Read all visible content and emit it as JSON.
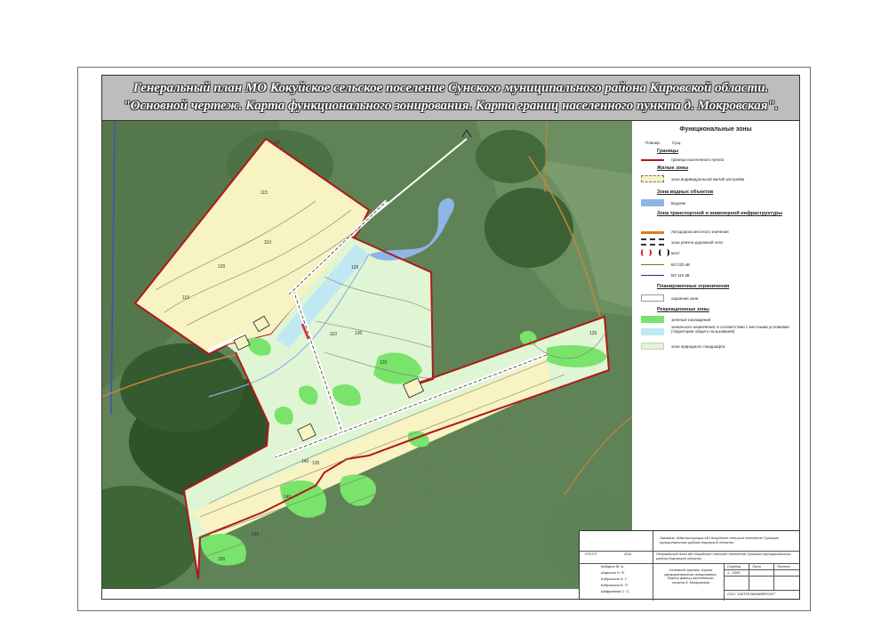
{
  "title": {
    "line1": "Генеральный план МО Кокуйское сельское поселение Сунского муниципального района Кировской области.",
    "line2": "\"Основной чертеж. Карта функционального зонирования. Карта границ населенного пункта д. Мокровская\"."
  },
  "map": {
    "contours": [
      "155",
      "140",
      "115",
      "110",
      "120",
      "115",
      "125",
      "130",
      "110",
      "125",
      "130",
      "135",
      "140",
      "145",
      "150"
    ]
  },
  "legend": {
    "title": "Функциональные зоны",
    "col_plan": "Планир.",
    "col_exist": "Сущ.",
    "sections": {
      "borders": "Границы",
      "living": "Жилые зоны",
      "water": "Зона водных объектов",
      "transport": "Зона транспортной и инженерной инфраструктуры",
      "restrictions": "Планировочные ограничения",
      "recreation": "Рекреационные зоны"
    },
    "items": {
      "border": "граница населенного пункта",
      "individual": "зона индивидуальной жилой застройки",
      "water": "Водоем",
      "road_local": "Автодорога местного значения",
      "street_net": "зона улично-дорожной сети",
      "bridge": "мост",
      "vl220": "ВЛ 220 кВ",
      "vl110": "ВЛ 110 кВ",
      "protect": "охранная зона",
      "green": "зеленые насаждения",
      "zonal": "зонального назначения, в соответствии с местными условиями (территории общего пользования)",
      "natural": "зона природного ландшафта"
    },
    "colors": {
      "border": "#b01818",
      "individual": "#f7f3c2",
      "water": "#8fb4e8",
      "road": "#e07b1e",
      "vl220": "#7a7a1e",
      "vl110": "#2a2a8a",
      "green": "#79e36b",
      "zonal": "#bfe8f2",
      "natural": "#dff5d3"
    }
  },
  "stamp": {
    "r1": "Заказчик: Администрация МО Кокуйское сельское поселение Сунского муниципального района Кировской области",
    "r2": "Генеральный план МО Кокуйское сельское поселение Сунского муниципального района Кировской области",
    "r3": "Основной чертеж. Карта функционального зонирования. Карта границ населенного пункта д. Мокровская",
    "org": "ООО \"САПТЕХКИМИВРОНТ\"",
    "scale": "1 : 2000",
    "h_stage": "Стадия",
    "h_sheet": "Лист",
    "h_sheets": "Листов",
    "names": [
      "Кабаров М. А.",
      "Шаронов Н. Ф.",
      "Бабушкина А. Г.",
      "Бабушкина Б. П.",
      "Шафранова С. С."
    ],
    "code": "070-ГП",
    "year": "2011"
  }
}
